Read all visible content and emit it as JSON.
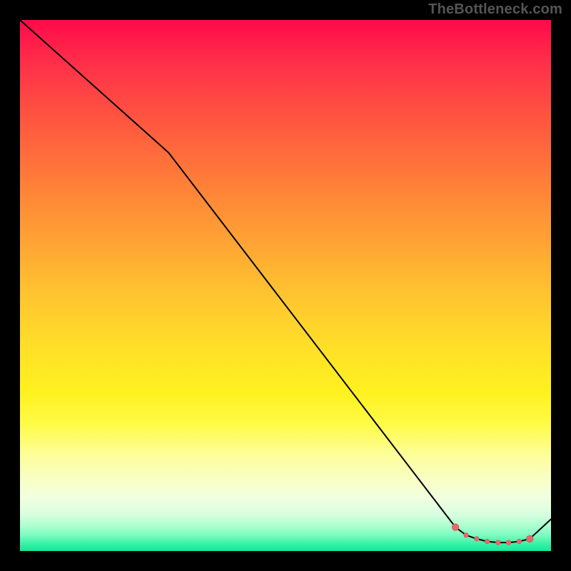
{
  "watermark": "TheBottleneck.com",
  "colors": {
    "page_bg": "#000000",
    "line": "#000000",
    "marker_fill": "#e46a6a",
    "marker_stroke": "#d25a5a",
    "gradient_top": "#ff0a4a",
    "gradient_bottom": "#14e79a"
  },
  "chart_data": {
    "type": "line",
    "title": "",
    "xlabel": "",
    "ylabel": "",
    "xlim": [
      0,
      100
    ],
    "ylim": [
      0,
      100
    ],
    "grid": false,
    "legend": false,
    "series": [
      {
        "name": "curve",
        "x": [
          0,
          28,
          82,
          84,
          86,
          88,
          90,
          92,
          94,
          96,
          100
        ],
        "y": [
          100,
          75,
          4.5,
          3,
          2.3,
          1.8,
          1.6,
          1.6,
          1.8,
          2.3,
          6
        ],
        "marker": [
          false,
          false,
          true,
          true,
          true,
          true,
          true,
          true,
          true,
          true,
          false
        ],
        "marker_size": [
          0,
          0,
          3,
          2,
          2,
          2,
          2,
          2,
          2,
          3,
          0
        ]
      }
    ],
    "annotations": []
  }
}
